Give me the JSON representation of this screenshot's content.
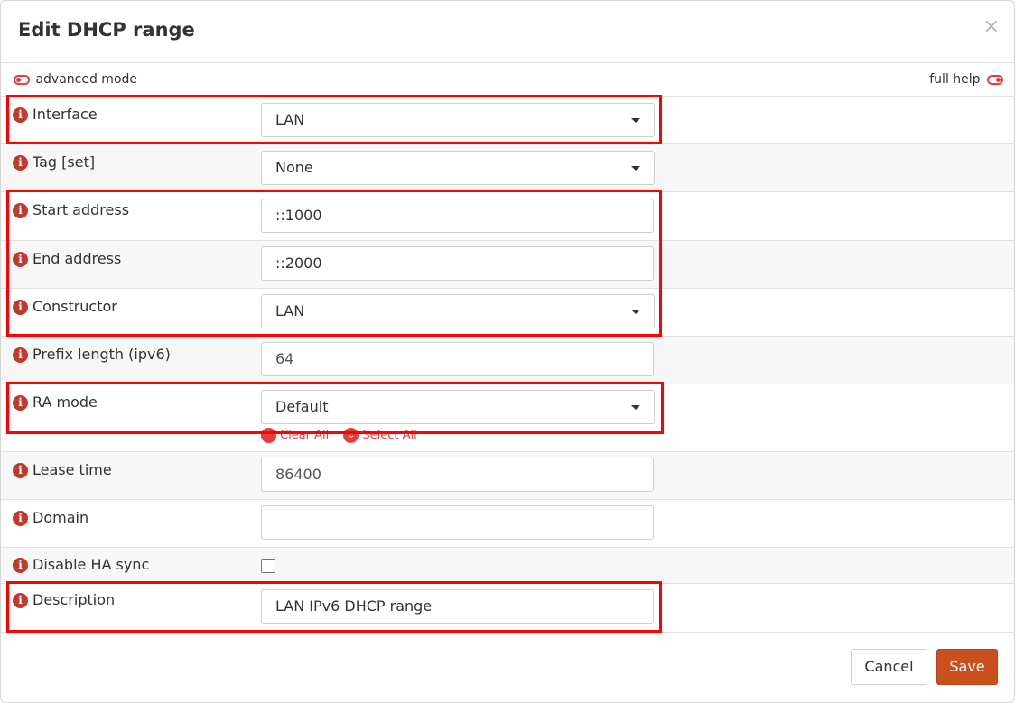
{
  "dialog": {
    "title": "Edit DHCP range",
    "close_symbol": "×"
  },
  "mode_bar": {
    "advanced_mode_label": "advanced mode",
    "full_help_label": "full help"
  },
  "fields": {
    "interface": {
      "label": "Interface",
      "value": "LAN"
    },
    "tag": {
      "label": "Tag [set]",
      "value": "None"
    },
    "start_address": {
      "label": "Start address",
      "value": "::1000"
    },
    "end_address": {
      "label": "End address",
      "value": "::2000"
    },
    "constructor": {
      "label": "Constructor",
      "value": "LAN"
    },
    "prefix_length": {
      "label": "Prefix length (ipv6)",
      "placeholder": "64"
    },
    "ra_mode": {
      "label": "RA mode",
      "value": "Default",
      "clear_all": "Clear All",
      "select_all": "Select All"
    },
    "lease_time": {
      "label": "Lease time",
      "placeholder": "86400"
    },
    "domain": {
      "label": "Domain",
      "value": ""
    },
    "disable_ha_sync": {
      "label": "Disable HA sync",
      "checked": false
    },
    "description": {
      "label": "Description",
      "value": "LAN IPv6 DHCP range"
    }
  },
  "buttons": {
    "cancel": "Cancel",
    "save": "Save"
  },
  "icons": {
    "info": "i",
    "chevron_up": "⌃",
    "chevron_down": "⌄"
  },
  "colors": {
    "accent": "#c9501c",
    "info_icon": "#c0392b",
    "toggle": "#e53e3e",
    "highlight": "#ff0000"
  }
}
